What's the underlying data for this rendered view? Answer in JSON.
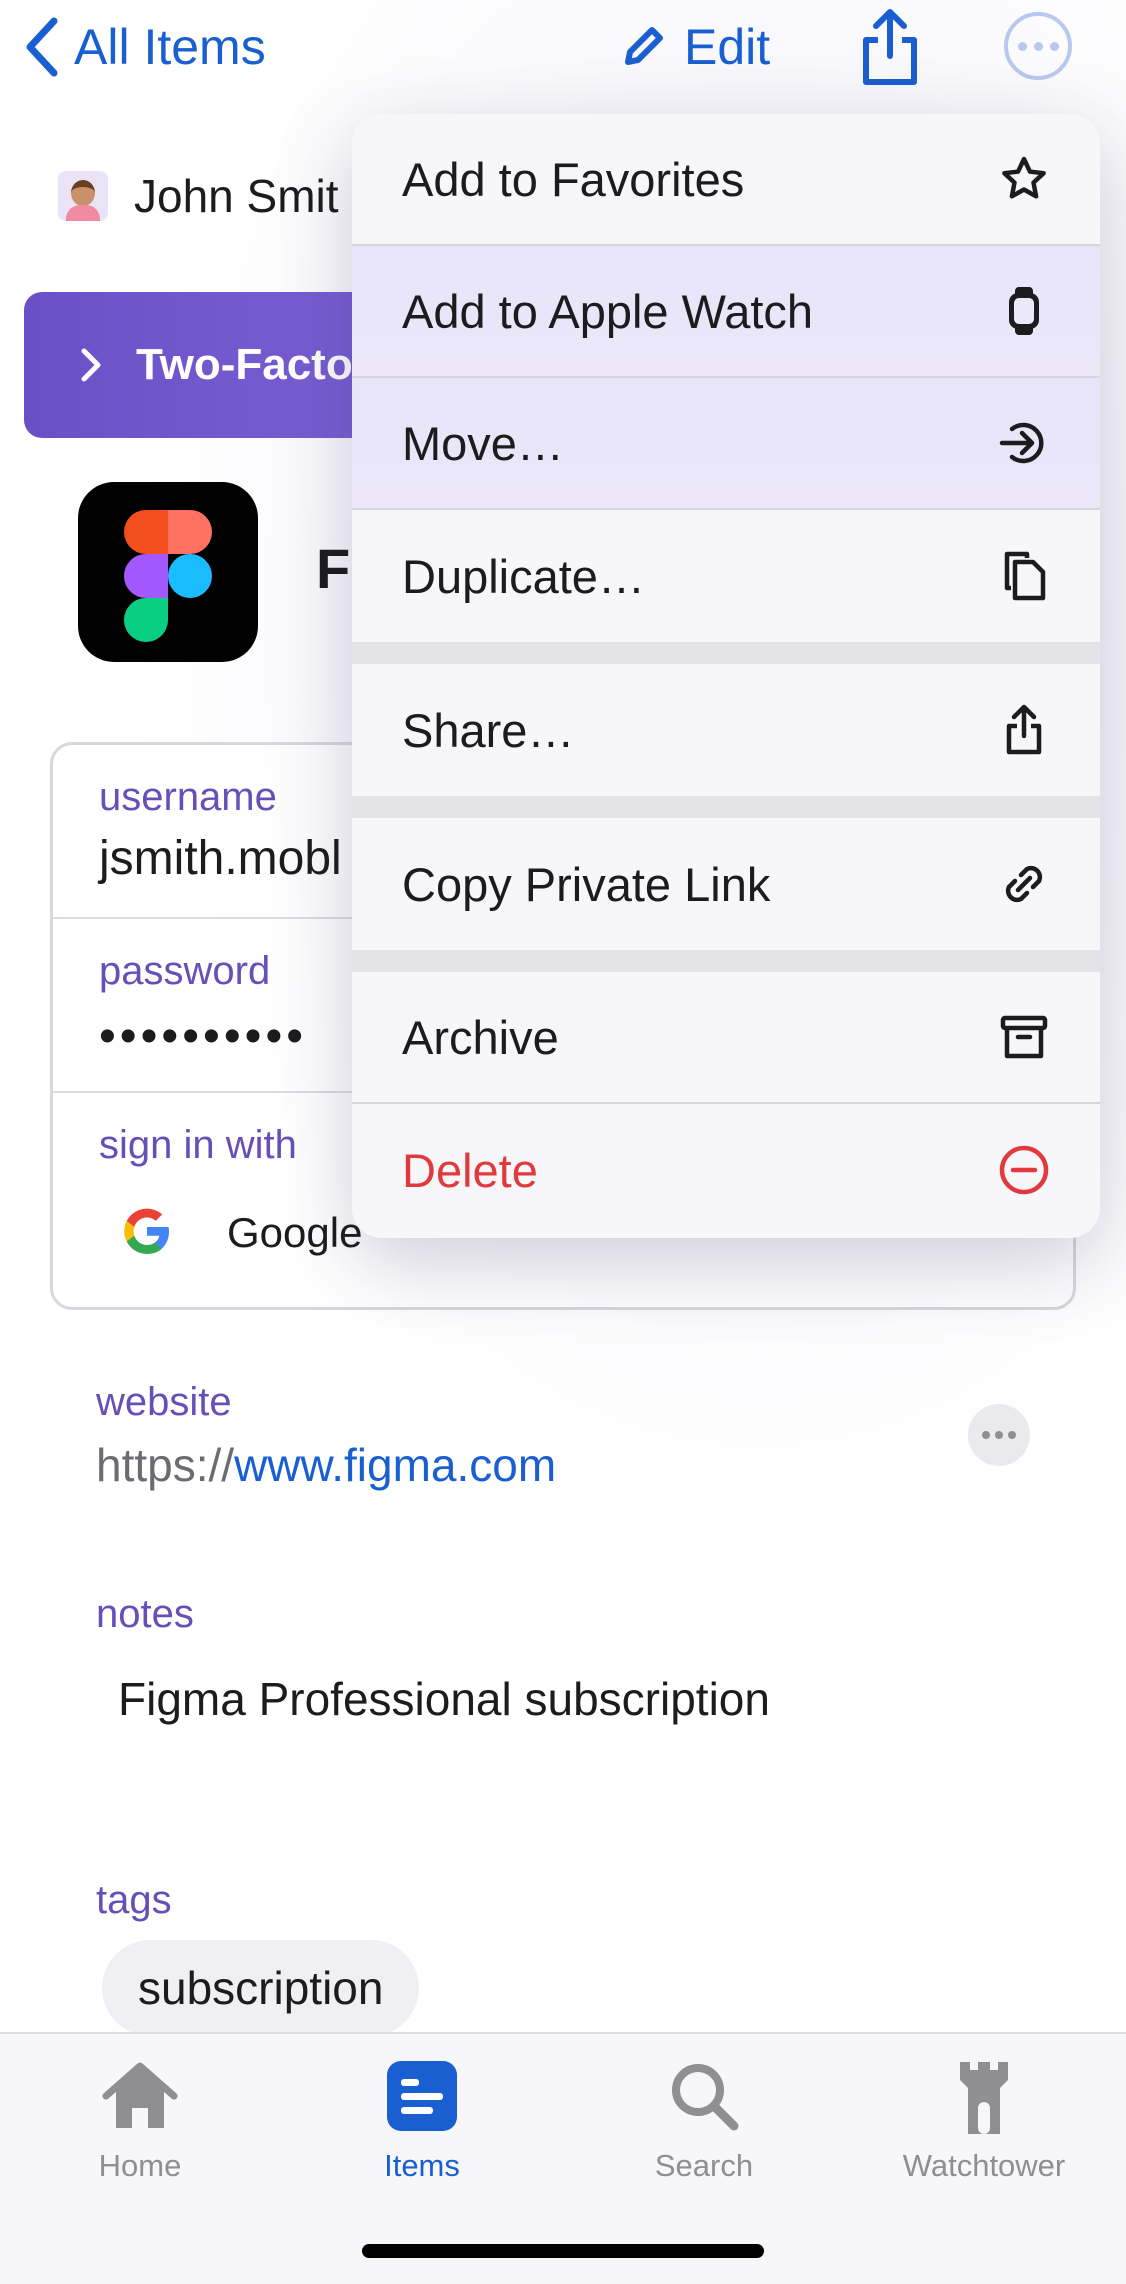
{
  "nav": {
    "back_label": "All Items",
    "edit_label": "Edit"
  },
  "owner": {
    "name": "John Smit"
  },
  "banner": {
    "label": "Two-Facto"
  },
  "item": {
    "title": "F"
  },
  "fields": {
    "username_label": "username",
    "username_value": "jsmith.mobl",
    "password_label": "password",
    "password_value": "••••••••••",
    "signin_label": "sign in with",
    "signin_value": "Google"
  },
  "website": {
    "label": "website",
    "prefix": "https://",
    "link": "www.figma.com"
  },
  "notes": {
    "label": "notes",
    "value": "Figma Professional subscription"
  },
  "tags": {
    "label": "tags",
    "items": [
      "subscription"
    ]
  },
  "menu": {
    "items": [
      {
        "label": "Add to Favorites",
        "icon": "star-icon"
      },
      {
        "label": "Add to Apple Watch",
        "icon": "watch-icon"
      },
      {
        "label": "Move…",
        "icon": "move-icon"
      },
      {
        "label": "Duplicate…",
        "icon": "duplicate-icon"
      },
      {
        "label": "Share…",
        "icon": "share-icon"
      },
      {
        "label": "Copy Private Link",
        "icon": "link-icon"
      },
      {
        "label": "Archive",
        "icon": "archive-icon"
      },
      {
        "label": "Delete",
        "icon": "delete-icon"
      }
    ]
  },
  "tabs": [
    {
      "label": "Home",
      "icon": "home-icon"
    },
    {
      "label": "Items",
      "icon": "items-icon"
    },
    {
      "label": "Search",
      "icon": "search-icon"
    },
    {
      "label": "Watchtower",
      "icon": "watchtower-icon"
    }
  ],
  "colors": {
    "accent": "#1a5fd1",
    "label_purple": "#6650b8",
    "danger": "#e0393e",
    "banner": "#6a4fc6"
  }
}
